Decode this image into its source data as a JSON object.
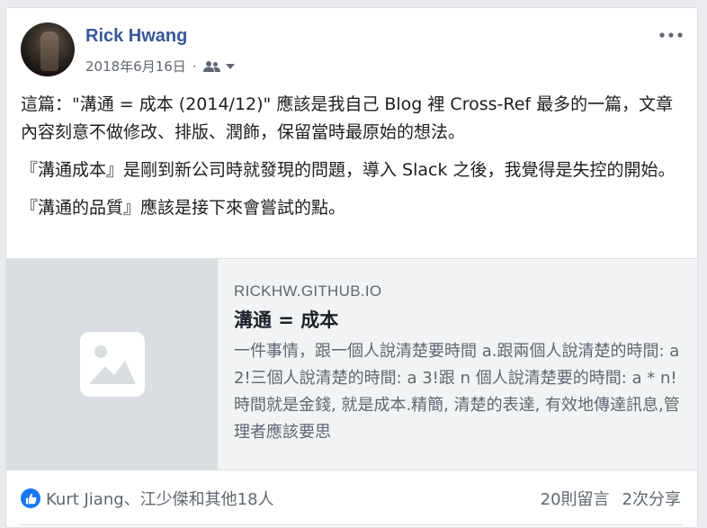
{
  "post": {
    "author": "Rick Hwang",
    "date": "2018年6月16日",
    "separator": "·",
    "audience_icon": "friends-icon",
    "more_icon": "more-options-icon",
    "paragraphs": [
      "這篇：\"溝通 = 成本 (2014/12)\" 應該是我自己 Blog 裡 Cross-Ref 最多的一篇，文章內容刻意不做修改、排版、潤飾，保留當時最原始的想法。",
      "『溝通成本』是剛到新公司時就發現的問題，導入 Slack 之後，我覺得是失控的開始。",
      "『溝通的品質』應該是接下來會嘗試的點。"
    ]
  },
  "link_preview": {
    "domain": "RICKHW.GITHUB.IO",
    "title": "溝通 = 成本",
    "description": "一件事情，跟一個人說清楚要時間 a.跟兩個人說清楚的時間: a 2!三個人說清楚的時間: a 3!跟 n 個人說清楚要的時間: a * n! 時間就是金錢, 就是成本.精簡, 清楚的表達, 有效地傳達訊息,管理者應該要思",
    "thumbnail_icon": "image-placeholder-icon"
  },
  "footer": {
    "reactions_text": "Kurt Jiang、江少傑和其他18人",
    "comments": "20則留言",
    "shares": "2次分享"
  },
  "colors": {
    "author": "#385898",
    "like": "#1877f2",
    "background": "#e9ebee"
  }
}
